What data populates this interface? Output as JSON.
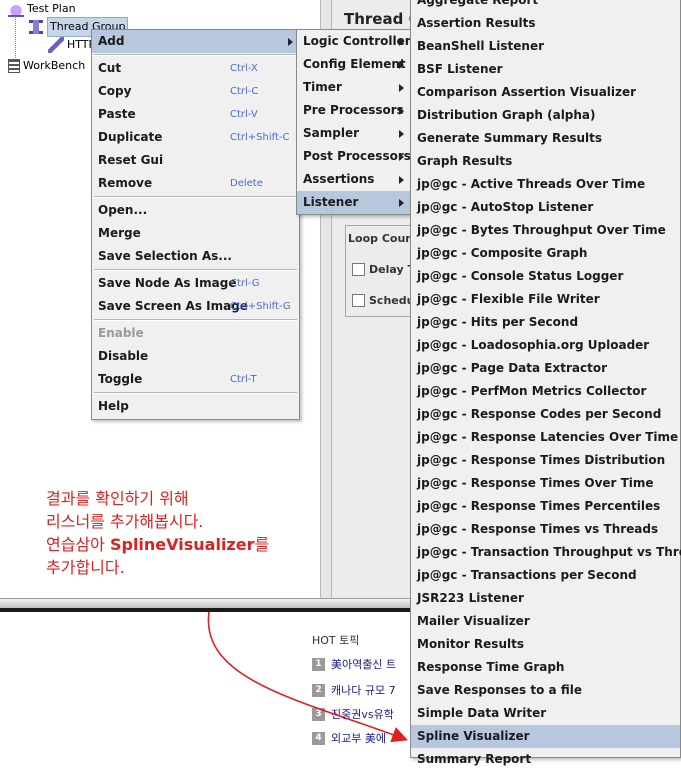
{
  "tree": {
    "test_plan": "Test Plan",
    "thread_group": "Thread Group",
    "http": "HTTP",
    "workbench": "WorkBench"
  },
  "right_pane": {
    "title": "Thread G",
    "loop_count": "Loop Coun",
    "delay": "Delay T",
    "scheduler": "Schedu"
  },
  "context_menu": {
    "items": [
      {
        "label": "Add",
        "shortcut": ""
      },
      {
        "label": "Cut",
        "shortcut": "Ctrl-X"
      },
      {
        "label": "Copy",
        "shortcut": "Ctrl-C"
      },
      {
        "label": "Paste",
        "shortcut": "Ctrl-V"
      },
      {
        "label": "Duplicate",
        "shortcut": "Ctrl+Shift-C"
      },
      {
        "label": "Reset Gui",
        "shortcut": ""
      },
      {
        "label": "Remove",
        "shortcut": "Delete"
      },
      {
        "label": "Open...",
        "shortcut": ""
      },
      {
        "label": "Merge",
        "shortcut": ""
      },
      {
        "label": "Save Selection As...",
        "shortcut": ""
      },
      {
        "label": "Save Node As Image",
        "shortcut": "Ctrl-G"
      },
      {
        "label": "Save Screen As Image",
        "shortcut": "Ctrl+Shift-G"
      },
      {
        "label": "Enable",
        "shortcut": ""
      },
      {
        "label": "Disable",
        "shortcut": ""
      },
      {
        "label": "Toggle",
        "shortcut": "Ctrl-T"
      },
      {
        "label": "Help",
        "shortcut": ""
      }
    ]
  },
  "add_submenu": {
    "items": [
      "Logic Controller",
      "Config Element",
      "Timer",
      "Pre Processors",
      "Sampler",
      "Post Processors",
      "Assertions",
      "Listener"
    ]
  },
  "listener_menu": {
    "items": [
      "Aggregate Report",
      "Assertion Results",
      "BeanShell Listener",
      "BSF Listener",
      "Comparison Assertion Visualizer",
      "Distribution Graph (alpha)",
      "Generate Summary Results",
      "Graph Results",
      "jp@gc - Active Threads Over Time",
      "jp@gc - AutoStop Listener",
      "jp@gc - Bytes Throughput Over Time",
      "jp@gc - Composite Graph",
      "jp@gc - Console Status Logger",
      "jp@gc - Flexible File Writer",
      "jp@gc - Hits per Second",
      "jp@gc - Loadosophia.org Uploader",
      "jp@gc - Page Data Extractor",
      "jp@gc - PerfMon Metrics Collector",
      "jp@gc - Response Codes per Second",
      "jp@gc - Response Latencies Over Time",
      "jp@gc - Response Times Distribution",
      "jp@gc - Response Times Over Time",
      "jp@gc - Response Times Percentiles",
      "jp@gc - Response Times vs Threads",
      "jp@gc - Transaction Throughput vs Threads",
      "jp@gc - Transactions per Second",
      "JSR223 Listener",
      "Mailer Visualizer",
      "Monitor Results",
      "Response Time Graph",
      "Save Responses to a file",
      "Simple Data Writer",
      "Spline Visualizer",
      "Summary Report"
    ]
  },
  "annotation": {
    "line1": "결과를 확인하기 위해",
    "line2": "리스너를 추가해봅시다.",
    "line3_pre": "연습삼아 ",
    "line3_bold": "SplineVisualizer",
    "line3_post": "를",
    "line4": "추가합니다."
  },
  "hot_topic": {
    "title": "HOT 토픽",
    "items": [
      {
        "num": "1",
        "text": "美아역출신 트"
      },
      {
        "num": "2",
        "text": "캐나다 규모 7"
      },
      {
        "num": "3",
        "text": "진중권vs유학"
      },
      {
        "num": "4",
        "text": "외교부 美에"
      }
    ]
  },
  "colors": {
    "menu_bg": "#f0f0f0",
    "highlight": "#b7c7dd",
    "shortcut": "#4a6bd0",
    "annotation": "#e02020"
  }
}
